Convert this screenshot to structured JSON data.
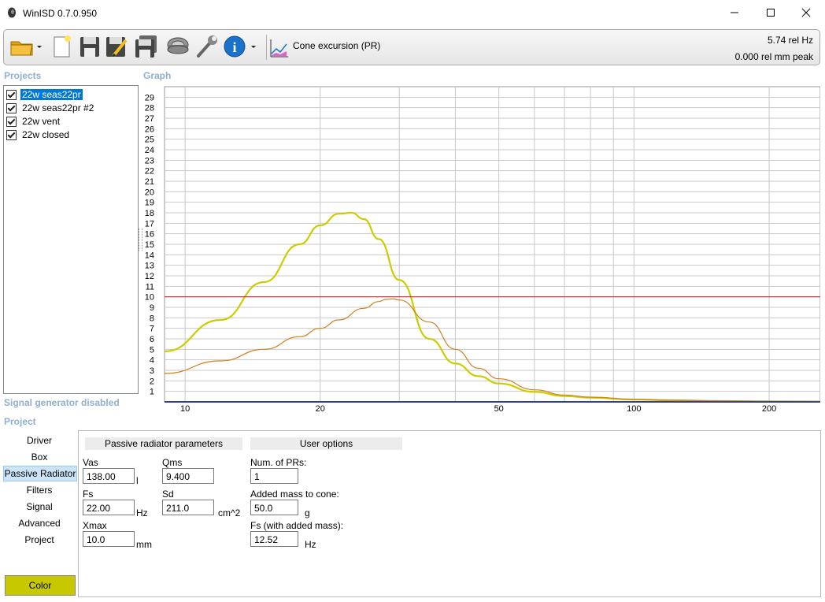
{
  "window": {
    "title": "WinISD 0.7.0.950"
  },
  "toolbar": {
    "graph_mode_label": "Cone excursion (PR)",
    "readout_freq": "5.74 rel Hz",
    "readout_exc": "0.000 rel mm peak"
  },
  "labels": {
    "projects": "Projects",
    "graph": "Graph",
    "signal_status": "Signal generator disabled",
    "project": "Project"
  },
  "projects": [
    {
      "name": "22w seas22pr",
      "checked": true,
      "selected": true
    },
    {
      "name": "22w seas22pr #2",
      "checked": true,
      "selected": false
    },
    {
      "name": "22w vent",
      "checked": true,
      "selected": false
    },
    {
      "name": "22w closed",
      "checked": true,
      "selected": false
    }
  ],
  "nav": [
    "Driver",
    "Box",
    "Passive Radiator",
    "Filters",
    "Signal",
    "Advanced",
    "Project"
  ],
  "nav_active": "Passive Radiator",
  "color_button": {
    "label": "Color",
    "color": "#c8c800"
  },
  "pr_params": {
    "header": "Passive radiator parameters",
    "vas": {
      "label": "Vas",
      "value": "138.00",
      "unit": "l"
    },
    "fs": {
      "label": "Fs",
      "value": "22.00",
      "unit": "Hz"
    },
    "xmax": {
      "label": "Xmax",
      "value": "10.0",
      "unit": "mm"
    },
    "qms": {
      "label": "Qms",
      "value": "9.400"
    },
    "sd": {
      "label": "Sd",
      "value": "211.0",
      "unit": "cm^2"
    }
  },
  "user_options": {
    "header": "User options",
    "num_prs": {
      "label": "Num. of PRs:",
      "value": "1"
    },
    "added_mass": {
      "label": "Added mass to cone:",
      "value": "50.0",
      "unit": "g"
    },
    "fs_added": {
      "label": "Fs (with added mass):",
      "value": "12.52",
      "unit": "Hz"
    }
  },
  "chart_data": {
    "type": "line",
    "xscale": "log",
    "xlim": [
      9,
      260
    ],
    "ylim": [
      0,
      30
    ],
    "x_ticks": [
      10,
      20,
      50,
      100,
      200
    ],
    "y_ticks": [
      1,
      2,
      3,
      4,
      5,
      6,
      7,
      8,
      9,
      10,
      11,
      12,
      13,
      14,
      15,
      16,
      17,
      18,
      19,
      20,
      21,
      22,
      23,
      24,
      25,
      26,
      27,
      28,
      29
    ],
    "grid": true,
    "series": [
      {
        "color": "#cccc00",
        "x": [
          9,
          12,
          15,
          18,
          20,
          22,
          23.5,
          25,
          27,
          30,
          35,
          40,
          45,
          50,
          60,
          70,
          80,
          100,
          120,
          150,
          200,
          260
        ],
        "y": [
          4.8,
          7.8,
          11.4,
          15.0,
          16.8,
          17.9,
          18.0,
          17.4,
          15.5,
          11.6,
          6.0,
          3.65,
          2.45,
          1.75,
          0.95,
          0.55,
          0.4,
          0.22,
          0.15,
          0.09,
          0.05,
          0.03
        ]
      },
      {
        "color": "#d08020",
        "x": [
          9,
          12,
          15,
          18,
          20,
          22,
          25,
          27,
          28,
          29,
          30,
          35,
          40,
          45,
          50,
          60,
          70,
          80,
          100,
          120,
          150,
          200,
          260
        ],
        "y": [
          2.7,
          3.9,
          5.0,
          6.2,
          7.0,
          7.8,
          8.9,
          9.55,
          9.75,
          9.8,
          9.7,
          7.6,
          5.0,
          3.2,
          2.2,
          1.15,
          0.65,
          0.45,
          0.25,
          0.16,
          0.1,
          0.05,
          0.03
        ]
      },
      {
        "color": "#c03030",
        "x": [
          9,
          260
        ],
        "y": [
          10,
          10
        ]
      },
      {
        "color": "#3040a0",
        "x": [
          9,
          260
        ],
        "y": [
          0,
          0
        ]
      }
    ]
  }
}
